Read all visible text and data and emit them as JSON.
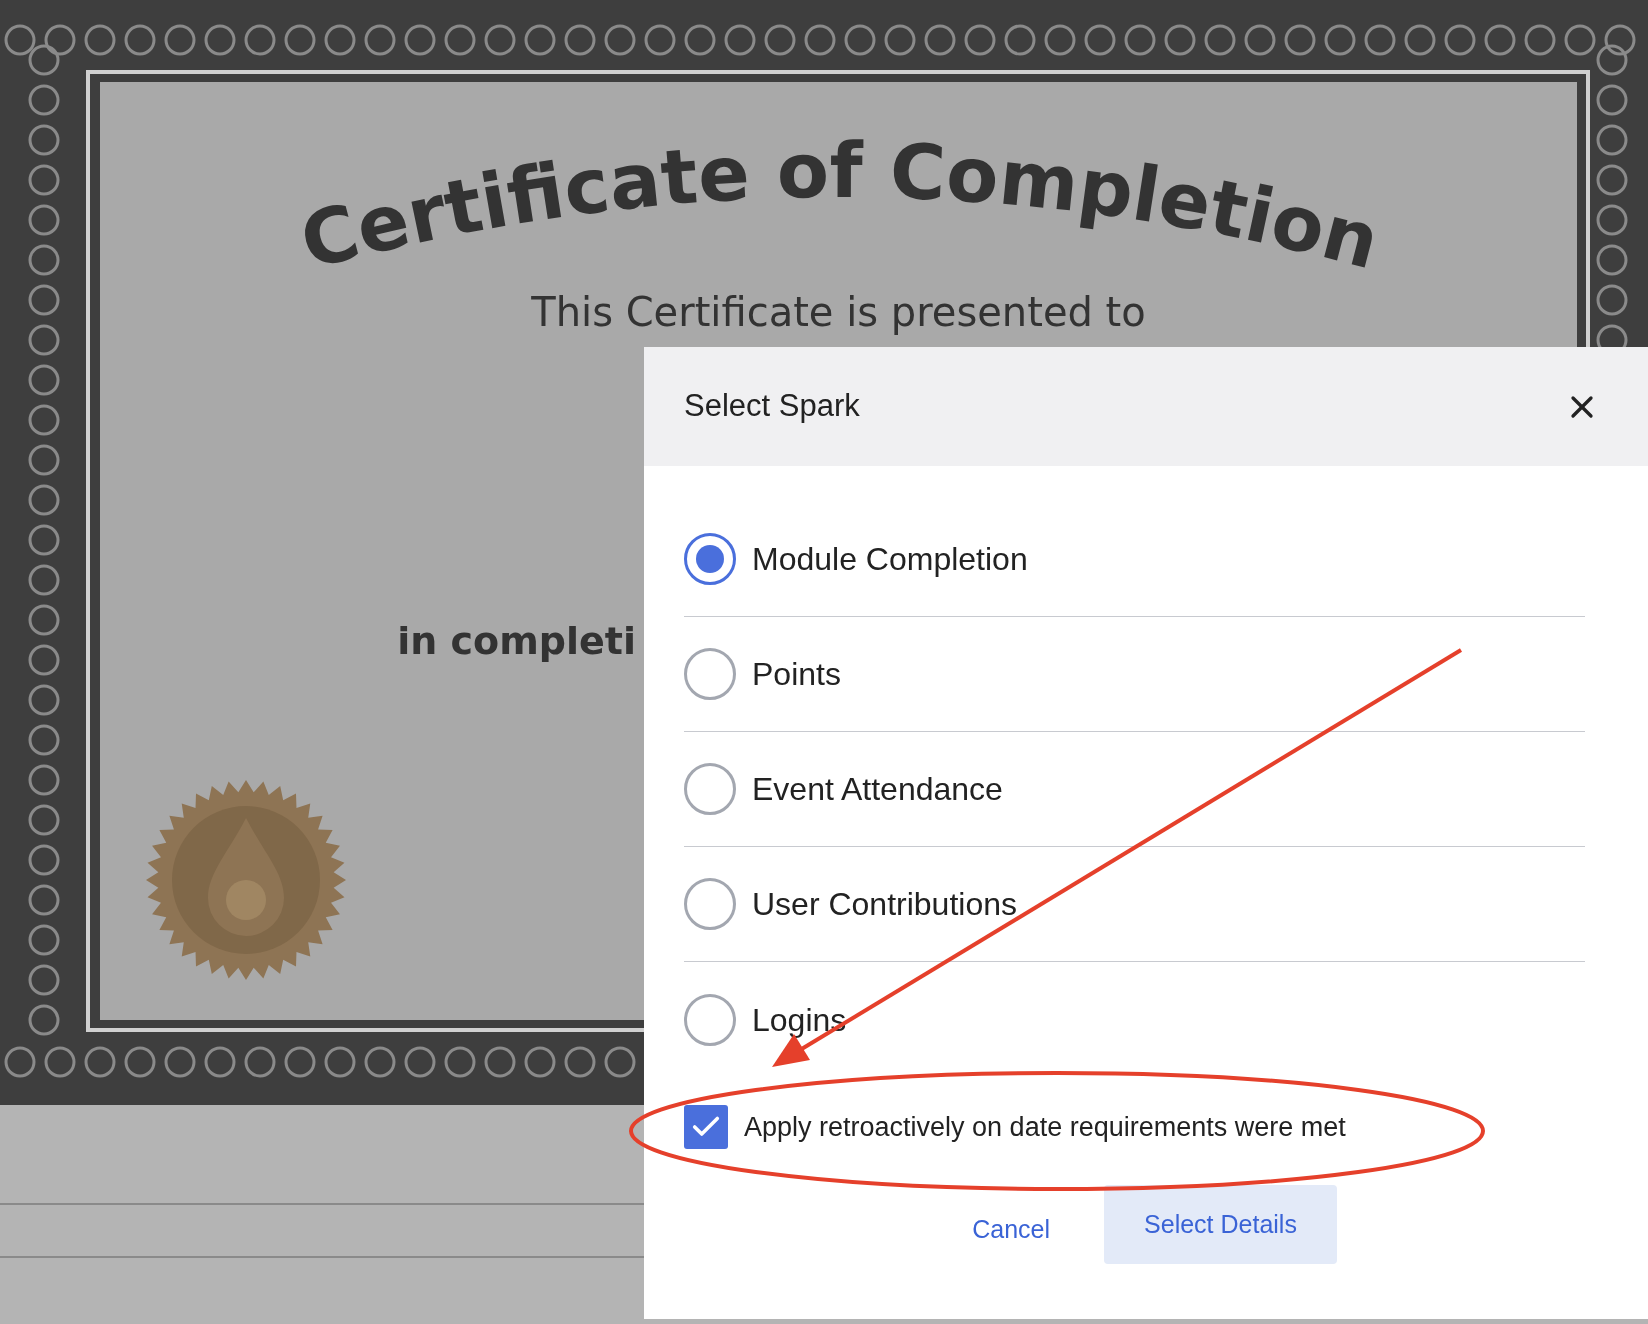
{
  "certificate": {
    "title": "Certificate of Completion",
    "presented_line": "This Certificate is presented to",
    "completion_line": "in completi"
  },
  "dialog": {
    "title": "Select Spark",
    "options": [
      {
        "label": "Module Completion",
        "selected": true
      },
      {
        "label": "Points",
        "selected": false
      },
      {
        "label": "Event Attendance",
        "selected": false
      },
      {
        "label": "User Contributions",
        "selected": false
      },
      {
        "label": "Logins",
        "selected": false
      }
    ],
    "retroactive": {
      "label": "Apply retroactively on date requirements were met",
      "checked": true
    },
    "buttons": {
      "cancel": "Cancel",
      "confirm": "Select Details"
    }
  }
}
